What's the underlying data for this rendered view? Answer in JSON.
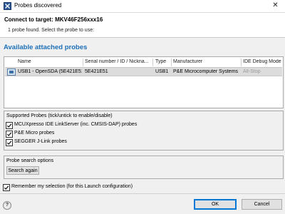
{
  "window": {
    "title": "Probes discovered",
    "close_symbol": "✕",
    "app_icon": "eclipse-x-icon",
    "close_icon": "close-icon"
  },
  "header": {
    "title": "Connect to target: MKV46F256xxx16",
    "description": "1 probe found. Select the probe to use:"
  },
  "section": {
    "title": "Available attached probes",
    "accent_color": "#1d6fb8"
  },
  "table": {
    "columns": [
      "Name",
      "Serial number / ID / Nickna...",
      "Type",
      "Manufacturer",
      "IDE Debug Mode"
    ],
    "rows": [
      {
        "icon": "usb-probe-icon",
        "name": "USB1 - OpenSDA (5E421E51)",
        "serial": "5E421E51",
        "type": "USB1",
        "manufacturer": "P&E Microcomputer Systems",
        "mode": "All-Stop"
      }
    ]
  },
  "supported_probes": {
    "label": "Supported Probes (tick/untick to enable/disable)",
    "items": [
      {
        "label": "MCUXpresso IDE LinkServer (inc. CMSIS-DAP) probes",
        "checked": true
      },
      {
        "label": "P&E Micro probes",
        "checked": true
      },
      {
        "label": "SEGGER J-Link probes",
        "checked": true
      }
    ]
  },
  "search": {
    "label": "Probe search options",
    "button": "Search again"
  },
  "remember": {
    "label": "Remember my selection (for this Launch configuration)",
    "checked": true
  },
  "footer": {
    "ok": "OK",
    "cancel": "Cancel",
    "help_symbol": "?",
    "help_icon": "help-icon"
  }
}
